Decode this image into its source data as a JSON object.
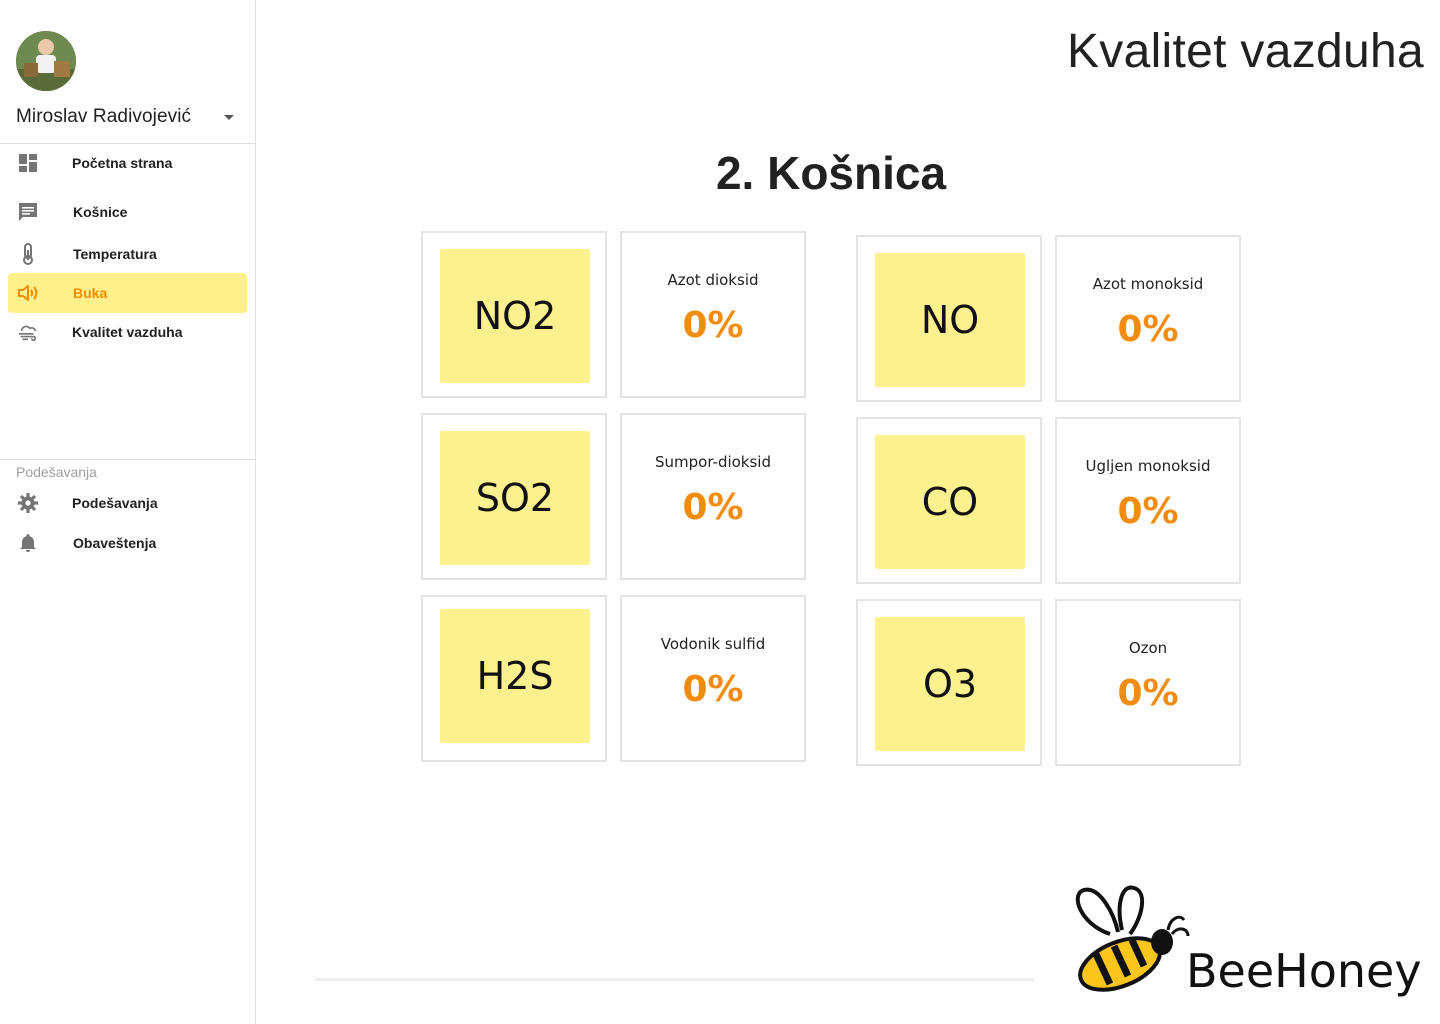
{
  "user": {
    "name": "Miroslav Radivojević"
  },
  "nav": {
    "items": [
      {
        "label": "Početna strana",
        "icon": "dashboard-icon"
      },
      {
        "label": "Košnice",
        "icon": "message-icon"
      },
      {
        "label": "Temperatura",
        "icon": "thermometer-icon"
      },
      {
        "label": "Buka",
        "icon": "speaker-icon",
        "active": true
      },
      {
        "label": "Kvalitet vazduha",
        "icon": "cloud-wind-icon"
      }
    ],
    "settings_section": "Podešavanja",
    "settings_items": [
      {
        "label": "Podešavanja",
        "icon": "gear-icon"
      },
      {
        "label": "Obaveštenja",
        "icon": "bell-icon"
      }
    ]
  },
  "page": {
    "title": "Kvalitet vazduha",
    "hive": "2. Košnica"
  },
  "gases": [
    {
      "code": "NO2",
      "name": "Azot dioksid",
      "value": "0%"
    },
    {
      "code": "SO2",
      "name": "Sumpor-dioksid",
      "value": "0%"
    },
    {
      "code": "H2S",
      "name": "Vodonik sulfid",
      "value": "0%"
    },
    {
      "code": "NO",
      "name": "Azot monoksid",
      "value": "0%"
    },
    {
      "code": "CO",
      "name": "Ugljen monoksid",
      "value": "0%"
    },
    {
      "code": "O3",
      "name": "Ozon",
      "value": "0%"
    }
  ],
  "brand": {
    "name": "BeeHoney"
  },
  "colors": {
    "accent": "#f28c0f",
    "highlight": "#fdf08f",
    "active_nav": "#fff08c"
  }
}
